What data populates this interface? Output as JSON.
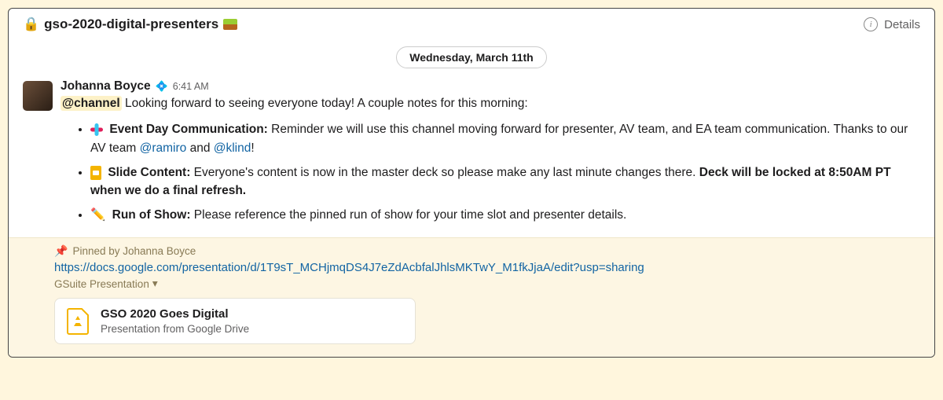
{
  "header": {
    "channel_name": "gso-2020-digital-presenters",
    "details_label": "Details"
  },
  "divider": {
    "date": "Wednesday, March 11th"
  },
  "message": {
    "author": "Johanna Boyce",
    "timestamp": "6:41 AM",
    "channel_mention": "@channel",
    "intro_text": " Looking forward to seeing everyone today! A couple notes for this morning:",
    "bullets": [
      {
        "title": "Event Day Communication:",
        "text_before": " Reminder we will use this channel moving forward for presenter, AV team, and EA team communication. Thanks to our AV team ",
        "mention1": "@ramiro",
        "between": " and ",
        "mention2": "@klind",
        "after": "!"
      },
      {
        "title": "Slide Content:",
        "text": " Everyone's content is now in the master deck so please make any last minute changes there. ",
        "bold_text": "Deck will be locked at 8:50AM PT when we do a final refresh."
      },
      {
        "title": "Run of Show:",
        "text": " Please reference the pinned run of show for your time slot and presenter details."
      }
    ]
  },
  "pinned": {
    "header": "Pinned by Johanna Boyce",
    "url": "https://docs.google.com/presentation/d/1T9sT_MCHjmqDS4J7eZdAcbfalJhlsMKTwY_M1fkJjaA/edit?usp=sharing",
    "attach_type": "GSuite Presentation",
    "attach_title": "GSO 2020 Goes Digital",
    "attach_sub": "Presentation from Google Drive"
  }
}
